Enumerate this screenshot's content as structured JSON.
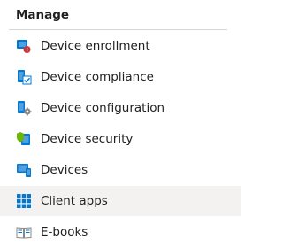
{
  "section": {
    "title": "Manage"
  },
  "items": [
    {
      "label": "Device enrollment",
      "icon": "device-enrollment-icon"
    },
    {
      "label": "Device compliance",
      "icon": "device-compliance-icon"
    },
    {
      "label": "Device configuration",
      "icon": "device-configuration-icon"
    },
    {
      "label": "Device security",
      "icon": "device-security-icon"
    },
    {
      "label": "Devices",
      "icon": "devices-icon"
    },
    {
      "label": "Client apps",
      "icon": "client-apps-icon",
      "selected": true
    },
    {
      "label": "E-books",
      "icon": "e-books-icon"
    }
  ],
  "colors": {
    "accent_blue": "#0078d4",
    "light_blue": "#50a0e0",
    "red": "#d13438",
    "green": "#6bb700",
    "gray": "#8a8886",
    "selected_bg": "#f3f2f1"
  }
}
